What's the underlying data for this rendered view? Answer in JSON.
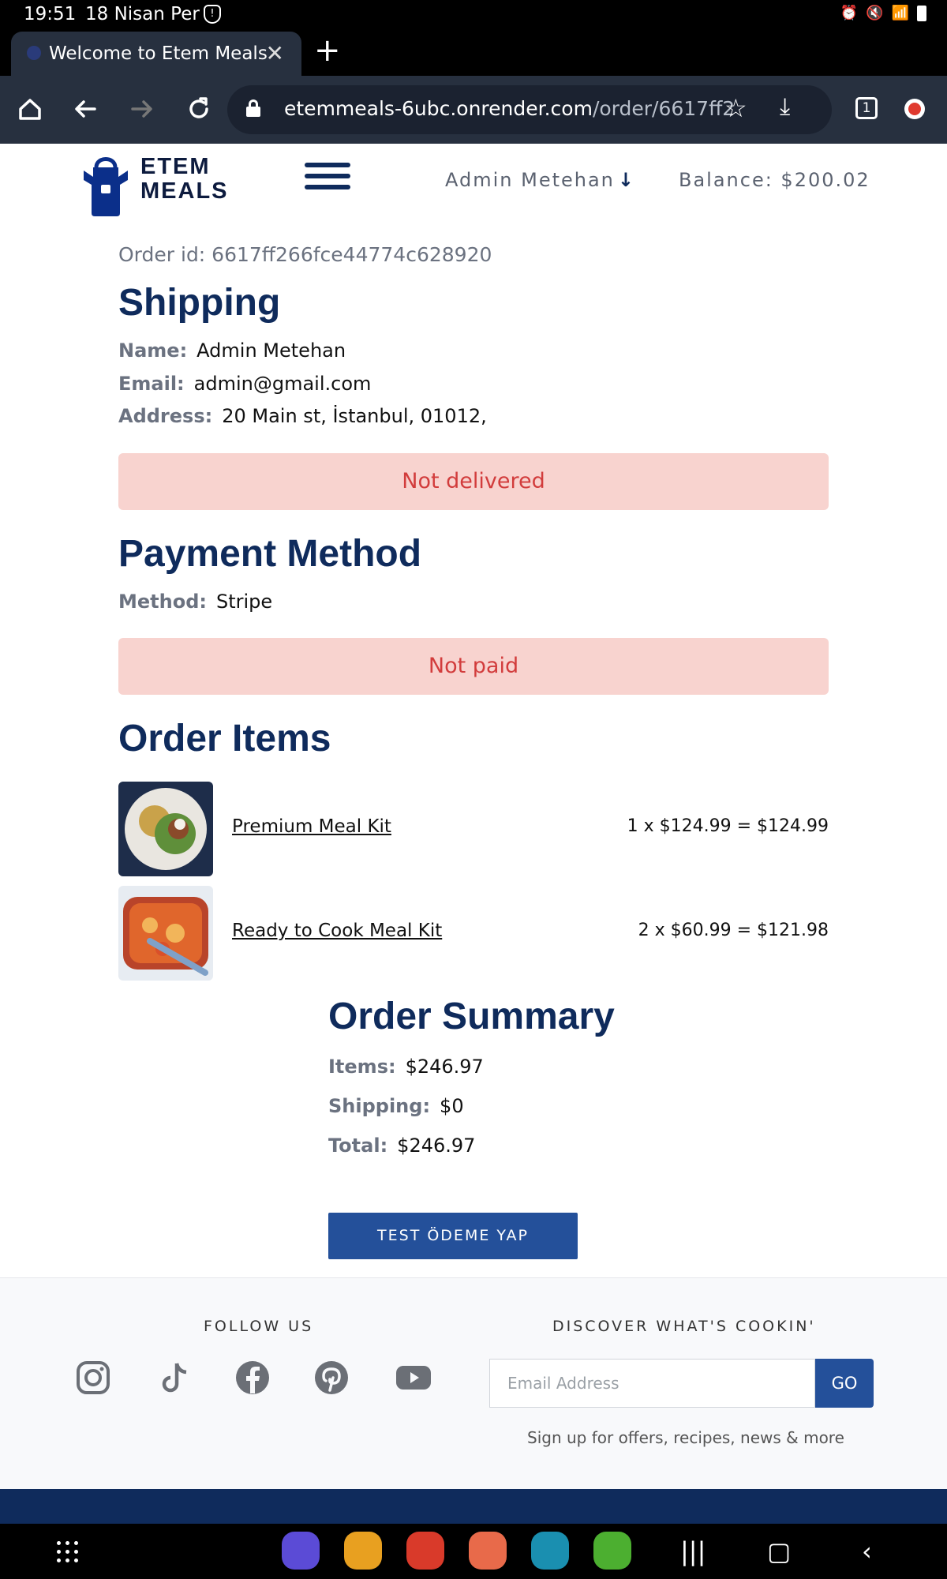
{
  "status_bar": {
    "time": "19:51",
    "date": "18 Nisan Per"
  },
  "browser": {
    "tab_title": "Welcome to Etem Meals",
    "url_host": "etemmeals-6ubc.onrender.com",
    "url_path": "/order/6617ff2",
    "tab_count": "1"
  },
  "header": {
    "brand_line1": "ETEM",
    "brand_line2": "MEALS",
    "user": "Admin Metehan",
    "balance": "Balance: $200.02"
  },
  "order": {
    "order_id": "Order id: 6617ff266fce44774c628920",
    "shipping_title": "Shipping",
    "name_label": "Name:",
    "name": "Admin Metehan",
    "email_label": "Email:",
    "email": "admin@gmail.com",
    "address_label": "Address:",
    "address": "20 Main st, İstanbul, 01012,",
    "delivery_status": "Not delivered",
    "payment_title": "Payment Method",
    "method_label": "Method:",
    "method": "Stripe",
    "payment_status": "Not paid",
    "items_title": "Order Items",
    "items": [
      {
        "name": "Premium Meal Kit",
        "price_line": "1 x $124.99 = $124.99"
      },
      {
        "name": "Ready to Cook Meal Kit",
        "price_line": "2 x $60.99 = $121.98"
      }
    ]
  },
  "summary": {
    "title": "Order Summary",
    "items_label": "Items:",
    "items_value": "$246.97",
    "shipping_label": "Shipping:",
    "shipping_value": "$0",
    "total_label": "Total:",
    "total_value": "$246.97",
    "pay_button": "TEST ÖDEME YAP"
  },
  "footer": {
    "follow_title": "FOLLOW US",
    "social_icons": [
      "instagram-icon",
      "tiktok-icon",
      "facebook-icon",
      "pinterest-icon",
      "youtube-icon"
    ],
    "discover_title": "DISCOVER WHAT'S COOKIN'",
    "email_placeholder": "Email Address",
    "go_button": "GO",
    "signup_text": "Sign up for offers, recipes, news & more"
  },
  "colors": {
    "brand_navy": "#0f2b5c",
    "button_blue": "#24509a",
    "alert_bg": "#f8d3cf",
    "alert_text": "#d23c3c"
  }
}
